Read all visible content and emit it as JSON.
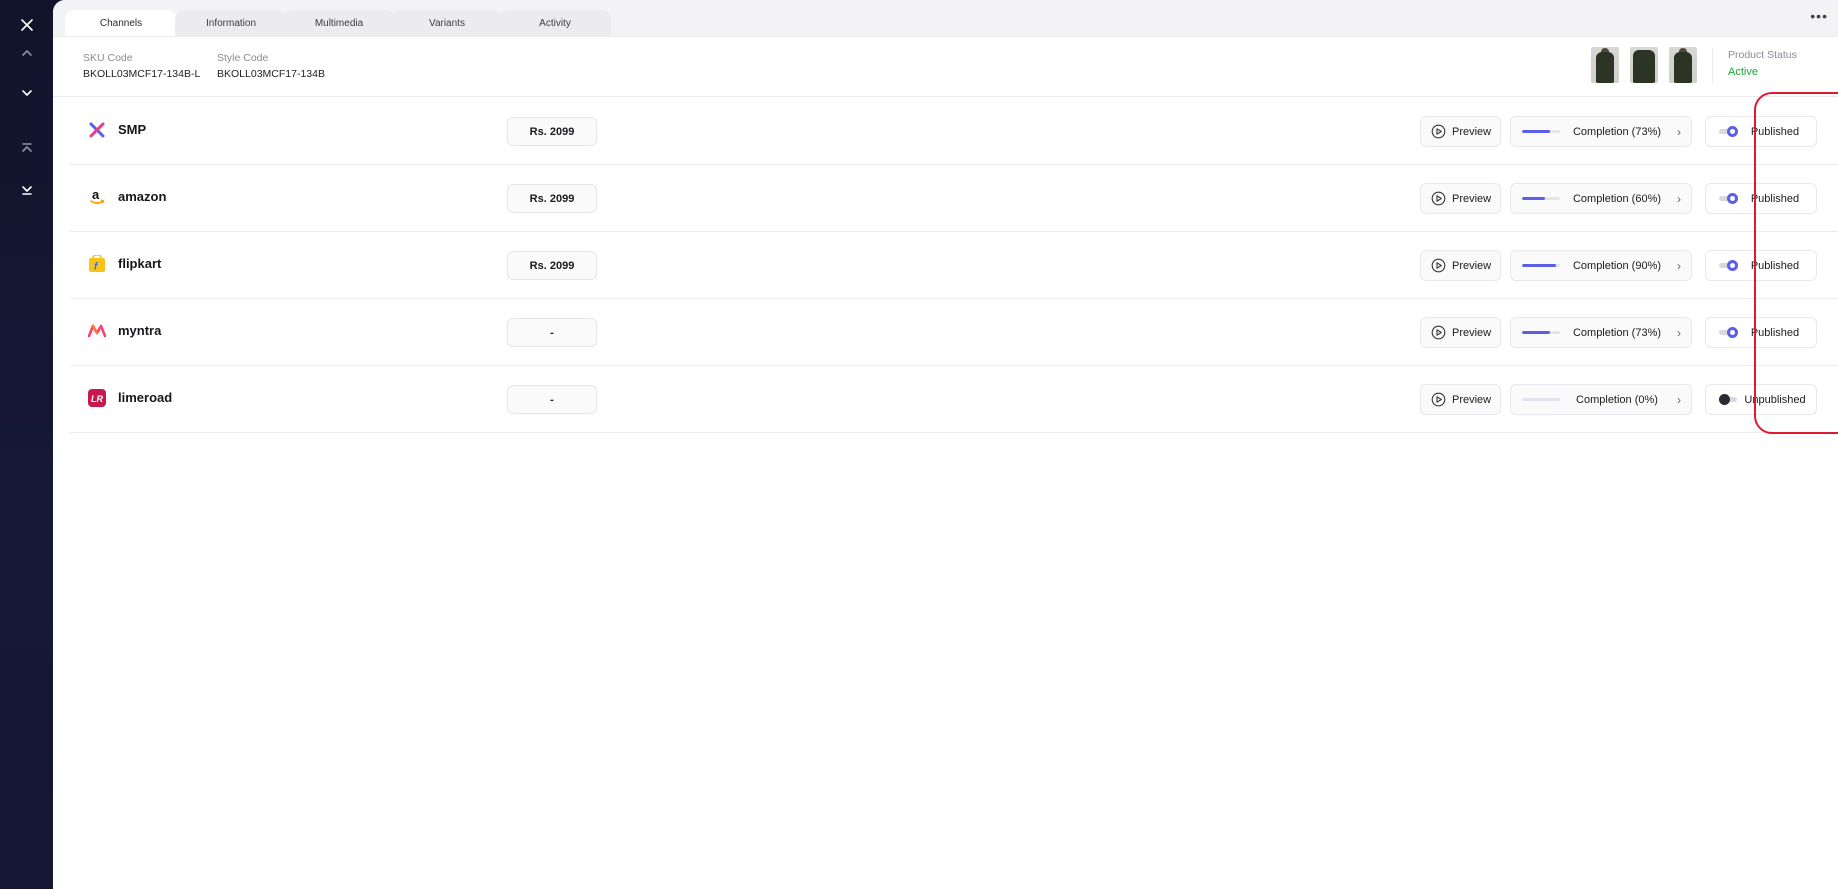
{
  "tabs": [
    {
      "label": "Channels",
      "active": true
    },
    {
      "label": "Information"
    },
    {
      "label": "Multimedia"
    },
    {
      "label": "Variants"
    },
    {
      "label": "Activity"
    }
  ],
  "more_label": "•••",
  "product": {
    "sku_label": "SKU Code",
    "sku_value": "BKOLL03MCF17-134B-L",
    "style_label": "Style Code",
    "style_value": "BKOLL03MCF17-134B",
    "status_label": "Product Status",
    "status_value": "Active",
    "status_color": "#1fa33a"
  },
  "colors": {
    "accent": "#5b5ee6",
    "highlight": "#e01933",
    "sidebar": "#12142b"
  },
  "channels": [
    {
      "name": "SMP",
      "logo": "smp-logo",
      "price": "Rs. 2099",
      "preview_label": "Preview",
      "completion_label": "Completion (73%)",
      "completion": 0.73,
      "publish_label": "Published",
      "published": true
    },
    {
      "name": "amazon",
      "logo": "amazon-logo",
      "price": "Rs. 2099",
      "preview_label": "Preview",
      "completion_label": "Completion (60%)",
      "completion": 0.6,
      "publish_label": "Published",
      "published": true
    },
    {
      "name": "flipkart",
      "logo": "flipkart-logo",
      "price": "Rs. 2099",
      "preview_label": "Preview",
      "completion_label": "Completion (90%)",
      "completion": 0.9,
      "publish_label": "Published",
      "published": true
    },
    {
      "name": "myntra",
      "logo": "myntra-logo",
      "price": "-",
      "preview_label": "Preview",
      "completion_label": "Completion (73%)",
      "completion": 0.73,
      "publish_label": "Published",
      "published": true
    },
    {
      "name": "limeroad",
      "logo": "limeroad-logo",
      "price": "-",
      "preview_label": "Preview",
      "completion_label": "Completion (0%)",
      "completion": 0,
      "publish_label": "Unpublished",
      "published": false
    }
  ]
}
